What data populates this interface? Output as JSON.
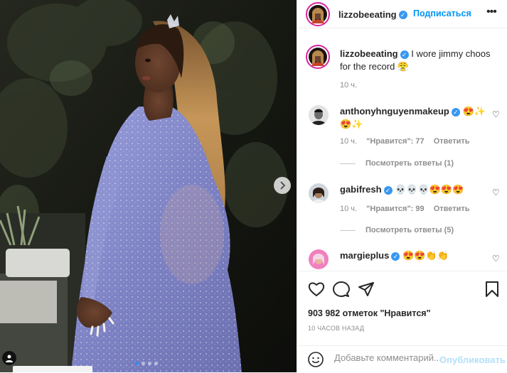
{
  "post_author": {
    "username": "lizzobeeating",
    "follow_label": "Подписаться",
    "more_label": "•••"
  },
  "caption": {
    "username": "lizzobeeating",
    "text": "I wore jimmy choos for the record 😤",
    "time": "10 ч."
  },
  "comments": [
    {
      "username": "anthonyhnguyenmakeup",
      "text": "😍✨ 😍✨",
      "time": "10 ч.",
      "likes": "\"Нравится\": 77",
      "reply_label": "Ответить",
      "replies": "Посмотреть ответы (1)"
    },
    {
      "username": "gabifresh",
      "text": "💀💀💀😍😍😍",
      "time": "10 ч.",
      "likes": "\"Нравится\": 99",
      "reply_label": "Ответить",
      "replies": "Посмотреть ответы (5)"
    },
    {
      "username": "margieplus",
      "text": "😍😍👏👏"
    }
  ],
  "likes_count": "903 982 отметок \"Нравится\"",
  "timestamp": "10 ЧАСОВ НАЗАД",
  "add_comment": {
    "placeholder": "Добавьте комментарий...",
    "publish_label": "Опубликовать"
  },
  "colors": {
    "accent": "#0095f6",
    "verified": "#3897f0",
    "dress": "#8a8fd0",
    "hair": "#b98a52"
  },
  "icons": [
    "chevron-right-icon",
    "user-tag-icon",
    "verified-icon",
    "heart-icon",
    "comment-icon",
    "share-icon",
    "bookmark-icon",
    "emoji-icon"
  ]
}
